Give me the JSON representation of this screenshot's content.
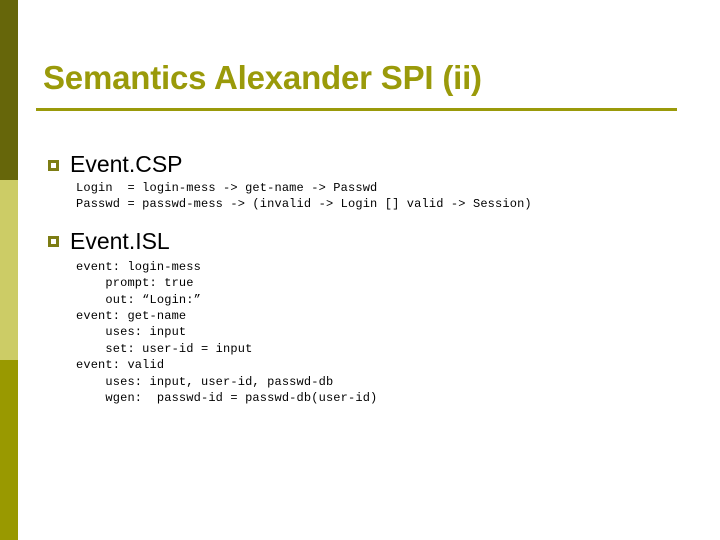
{
  "slide": {
    "title": "Semantics Alexander SPI (ii)",
    "accent_color": "#9a9a0a",
    "background_color": "#ffffff",
    "text_color": "#000000"
  },
  "sidebar": {
    "segments": [
      {
        "name": "top",
        "color": "#66660a"
      },
      {
        "name": "middle",
        "color": "#cccc66"
      },
      {
        "name": "bottom",
        "color": "#999900"
      }
    ]
  },
  "content": {
    "sections": [
      {
        "heading": "Event.CSP",
        "bullet_icon": "hollow-square-bullet",
        "code": "Login  = login-mess -> get-name -> Passwd\nPasswd = passwd-mess -> (invalid -> Login [] valid -> Session)"
      },
      {
        "heading": "Event.ISL",
        "bullet_icon": "hollow-square-bullet",
        "code": "event: login-mess\n    prompt: true\n    out: “Login:”\nevent: get-name\n    uses: input\n    set: user-id = input\nevent: valid\n    uses: input, user-id, passwd-db\n    wgen:  passwd-id = passwd-db(user-id)"
      }
    ]
  }
}
